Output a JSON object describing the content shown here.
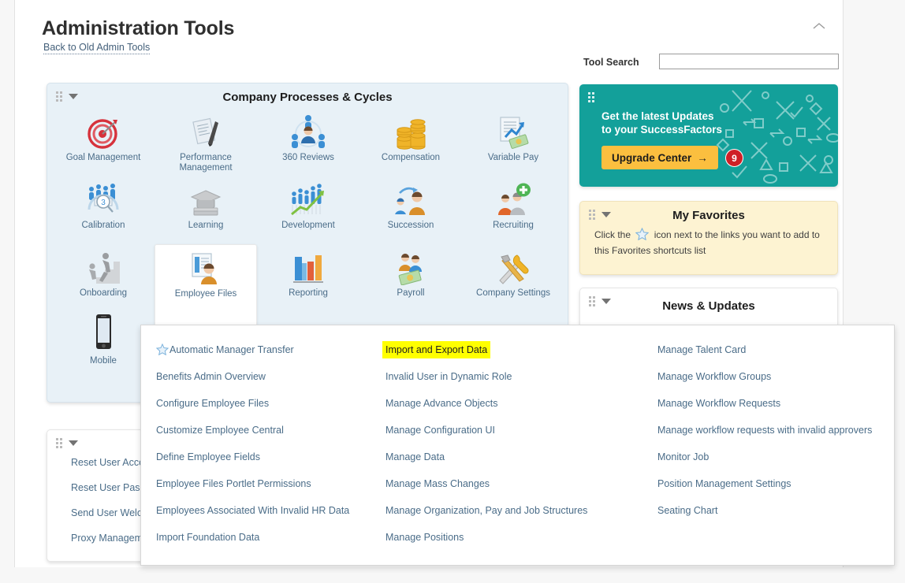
{
  "header": {
    "title": "Administration Tools",
    "back_link": "Back to Old Admin Tools",
    "collapse_icon": "chevron-up-icon",
    "tool_search_label": "Tool Search",
    "tool_search_value": "",
    "tool_search_placeholder": ""
  },
  "processes_portlet": {
    "title": "Company Processes & Cycles",
    "background": "#e8f1f7",
    "tiles": [
      {
        "label": "Goal Management",
        "icon": "target-icon"
      },
      {
        "label": "Performance Management",
        "icon": "document-pen-icon"
      },
      {
        "label": "360 Reviews",
        "icon": "people-circle-icon"
      },
      {
        "label": "Compensation",
        "icon": "coins-icon"
      },
      {
        "label": "Variable Pay",
        "icon": "chart-money-icon"
      },
      {
        "label": "Calibration",
        "icon": "people-gauge-icon"
      },
      {
        "label": "Learning",
        "icon": "graduation-cap-icon"
      },
      {
        "label": "Development",
        "icon": "growth-chart-icon"
      },
      {
        "label": "Succession",
        "icon": "people-arrow-icon"
      },
      {
        "label": "Recruiting",
        "icon": "person-plus-icon"
      },
      {
        "label": "Onboarding",
        "icon": "person-stairs-icon"
      },
      {
        "label": "Employee Files",
        "icon": "employee-file-icon",
        "hovered": true
      },
      {
        "label": "Reporting",
        "icon": "bar-chart-icon"
      },
      {
        "label": "Payroll",
        "icon": "people-money-icon"
      },
      {
        "label": "Company Settings",
        "icon": "hammer-wrench-icon"
      },
      {
        "label": "Mobile",
        "icon": "smartphone-icon"
      }
    ]
  },
  "upgrade_banner": {
    "line1": "Get the latest Updates",
    "line2": "to your SuccessFactors",
    "button_label": "Upgrade Center",
    "button_arrow": "arrow-right-icon",
    "badge_count": "9",
    "background": "#13a09a",
    "button_color": "#fbbf3f",
    "badge_color": "#cf2027"
  },
  "favorites_portlet": {
    "title": "My Favorites",
    "text_before": "Click the",
    "star_icon": "star-outline-icon",
    "text_after": "icon next to the links you want to add to this Favorites shortcuts list",
    "background": "#fdf3d2"
  },
  "news_portlet": {
    "title": "News & Updates"
  },
  "user_links_portlet": {
    "items": [
      "Reset User Acco",
      "Reset User Pass",
      "Send User Welco",
      "Proxy Manageme"
    ]
  },
  "mega_menu": {
    "highlight_color": "#ffff00",
    "columns": [
      {
        "name": "column-1",
        "items": [
          {
            "label": "Automatic Manager Transfer",
            "star": true
          },
          {
            "label": "Benefits Admin Overview"
          },
          {
            "label": "Configure Employee Files"
          },
          {
            "label": "Customize Employee Central"
          },
          {
            "label": "Define Employee Fields"
          },
          {
            "label": "Employee Files Portlet Permissions"
          },
          {
            "label": "Employees Associated With Invalid HR Data"
          },
          {
            "label": "Import Foundation Data"
          }
        ]
      },
      {
        "name": "column-2",
        "items": [
          {
            "label": "Import and Export Data",
            "highlighted": true
          },
          {
            "label": "Invalid User in Dynamic Role"
          },
          {
            "label": "Manage Advance Objects"
          },
          {
            "label": "Manage Configuration UI"
          },
          {
            "label": "Manage Data"
          },
          {
            "label": "Manage Mass Changes"
          },
          {
            "label": "Manage Organization, Pay and Job Structures"
          },
          {
            "label": "Manage Positions"
          }
        ]
      },
      {
        "name": "column-3",
        "items": [
          {
            "label": "Manage Talent Card"
          },
          {
            "label": "Manage Workflow Groups"
          },
          {
            "label": "Manage Workflow Requests"
          },
          {
            "label": "Manage workflow requests with invalid approvers"
          },
          {
            "label": "Monitor Job"
          },
          {
            "label": "Position Management Settings"
          },
          {
            "label": "Seating Chart"
          }
        ]
      }
    ]
  }
}
